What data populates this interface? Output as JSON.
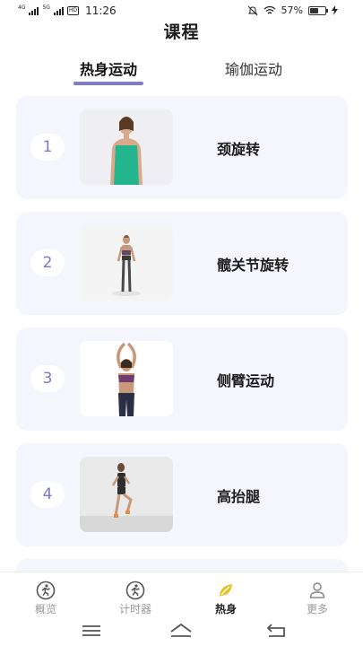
{
  "status_bar": {
    "sim1_label": "4G",
    "sim2_label": "5G",
    "hd_label": "HD",
    "time": "11:26",
    "battery_text": "57%",
    "battery_level": 0.57
  },
  "page_title": "课程",
  "tabs": [
    {
      "label": "热身运动",
      "active": true
    },
    {
      "label": "瑜伽运动",
      "active": false
    }
  ],
  "courses": [
    {
      "index": "1",
      "name": "颈旋转",
      "image": "woman-teal-tanktop-photo"
    },
    {
      "index": "2",
      "name": "髋关节旋转",
      "image": "woman-standing-sportswear-photo"
    },
    {
      "index": "3",
      "name": "侧臂运动",
      "image": "woman-arms-raised-photo"
    },
    {
      "index": "4",
      "name": "高抬腿",
      "image": "woman-high-knees-photo"
    }
  ],
  "bottom_nav": [
    {
      "label": "概览",
      "icon": "runner-circle-icon",
      "active": false
    },
    {
      "label": "计时器",
      "icon": "runner-circle-icon",
      "active": false
    },
    {
      "label": "热身",
      "icon": "warmup-leaf-icon",
      "active": true
    },
    {
      "label": "更多",
      "icon": "person-icon",
      "active": false
    }
  ],
  "system_nav": [
    "menu-icon",
    "home-icon",
    "back-icon"
  ],
  "colors": {
    "accent": "#8379cf",
    "card_bg": "#f5f5fe",
    "active_icon": "#e6c21e"
  }
}
